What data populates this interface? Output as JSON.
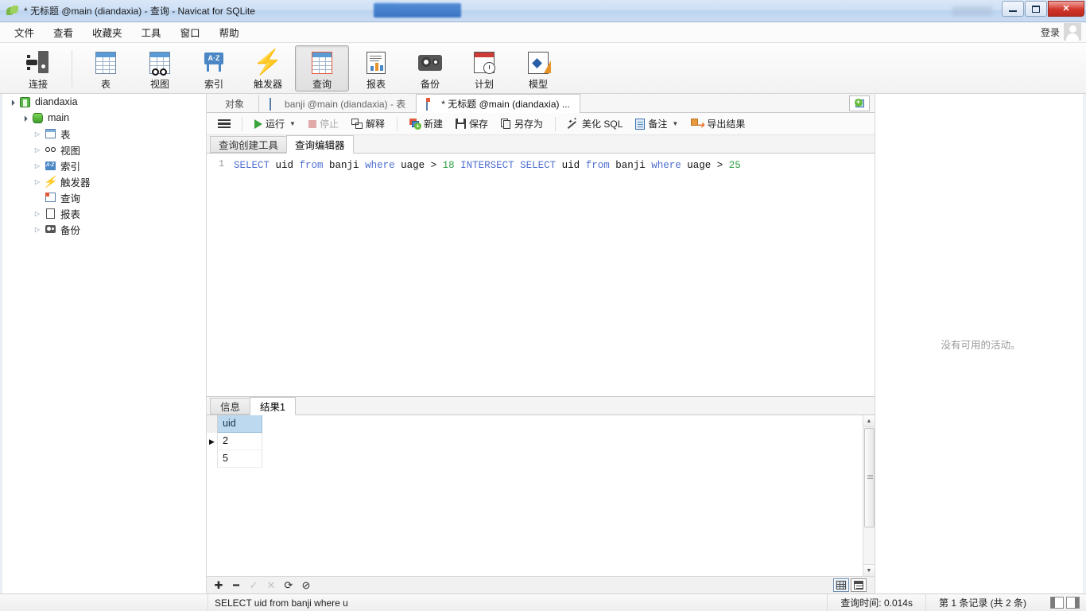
{
  "window": {
    "title": "* 无标题 @main (diandaxia) - 查询 - Navicat for SQLite",
    "app_icon": "navicat-leaf-icon",
    "minimize": "–",
    "maximize": "□",
    "close": "✕"
  },
  "menubar": {
    "items": [
      {
        "label": "文件"
      },
      {
        "label": "查看"
      },
      {
        "label": "收藏夹"
      },
      {
        "label": "工具"
      },
      {
        "label": "窗口"
      },
      {
        "label": "帮助"
      }
    ],
    "login_label": "登录"
  },
  "toolbar": {
    "items": [
      {
        "label": "连接",
        "icon": "connection-icon",
        "active": false
      },
      {
        "label": "表",
        "icon": "table-icon",
        "active": false
      },
      {
        "label": "视图",
        "icon": "view-icon",
        "active": false
      },
      {
        "label": "索引",
        "icon": "index-icon",
        "active": false
      },
      {
        "label": "触发器",
        "icon": "trigger-icon",
        "active": false
      },
      {
        "label": "查询",
        "icon": "query-icon",
        "active": true
      },
      {
        "label": "报表",
        "icon": "report-icon",
        "active": false
      },
      {
        "label": "备份",
        "icon": "backup-icon",
        "active": false
      },
      {
        "label": "计划",
        "icon": "schedule-icon",
        "active": false
      },
      {
        "label": "模型",
        "icon": "model-icon",
        "active": false
      }
    ]
  },
  "sidebar": {
    "items": [
      {
        "label": "diandaxia",
        "icon": "connection-node-icon",
        "depth": 0,
        "twisty": "open"
      },
      {
        "label": "main",
        "icon": "database-icon",
        "depth": 1,
        "twisty": "open"
      },
      {
        "label": "表",
        "icon": "table-folder-icon",
        "depth": 2,
        "twisty": "closed"
      },
      {
        "label": "视图",
        "icon": "view-folder-icon",
        "depth": 2,
        "twisty": "closed"
      },
      {
        "label": "索引",
        "icon": "index-folder-icon",
        "depth": 2,
        "twisty": "closed"
      },
      {
        "label": "触发器",
        "icon": "trigger-folder-icon",
        "depth": 2,
        "twisty": "closed"
      },
      {
        "label": "查询",
        "icon": "query-folder-icon",
        "depth": 2,
        "twisty": "none"
      },
      {
        "label": "报表",
        "icon": "report-folder-icon",
        "depth": 2,
        "twisty": "closed"
      },
      {
        "label": "备份",
        "icon": "backup-folder-icon",
        "depth": 2,
        "twisty": "closed"
      }
    ]
  },
  "tabstrip": {
    "object_tab": "对象",
    "tabs": [
      {
        "label": "banji @main (diandaxia) - 表",
        "icon": "table-tab-icon",
        "active": false
      },
      {
        "label": "* 无标题 @main (diandaxia) ...",
        "icon": "query-tab-icon",
        "active": true
      }
    ],
    "new_tab": "new-tab-button"
  },
  "query_toolbar": {
    "menu": "菜单",
    "run": "运行",
    "stop": "停止",
    "explain": "解释",
    "new": "新建",
    "save": "保存",
    "save_as": "另存为",
    "beautify": "美化 SQL",
    "note": "备注",
    "export": "导出结果"
  },
  "editor_tabs": [
    {
      "label": "查询创建工具",
      "active": false
    },
    {
      "label": "查询编辑器",
      "active": true
    }
  ],
  "editor": {
    "line_number": "1",
    "sql_tokens": [
      {
        "t": "SELECT",
        "c": "kw"
      },
      {
        "t": " uid ",
        "c": "id"
      },
      {
        "t": "from",
        "c": "kw"
      },
      {
        "t": " banji ",
        "c": "id"
      },
      {
        "t": "where",
        "c": "kw"
      },
      {
        "t": " uage > ",
        "c": "id"
      },
      {
        "t": "18",
        "c": "num"
      },
      {
        "t": " ",
        "c": "id"
      },
      {
        "t": "INTERSECT",
        "c": "kw"
      },
      {
        "t": " ",
        "c": "id"
      },
      {
        "t": "SELECT",
        "c": "kw"
      },
      {
        "t": " uid ",
        "c": "id"
      },
      {
        "t": "from",
        "c": "kw"
      },
      {
        "t": " banji ",
        "c": "id"
      },
      {
        "t": "where",
        "c": "kw"
      },
      {
        "t": " uage > ",
        "c": "id"
      },
      {
        "t": "25",
        "c": "num"
      }
    ]
  },
  "results": {
    "tabs": [
      {
        "label": "信息",
        "active": false
      },
      {
        "label": "结果1",
        "active": true
      }
    ],
    "columns": [
      "uid"
    ],
    "rows": [
      {
        "cells": [
          "2"
        ],
        "current": true
      },
      {
        "cells": [
          "5"
        ],
        "current": false
      }
    ],
    "grid_toolbar": [
      {
        "name": "add-record-button",
        "glyph": "✚",
        "disabled": false
      },
      {
        "name": "delete-record-button",
        "glyph": "━",
        "disabled": false
      },
      {
        "name": "apply-changes-button",
        "glyph": "✓",
        "disabled": true
      },
      {
        "name": "cancel-changes-button",
        "glyph": "✕",
        "disabled": true
      },
      {
        "name": "refresh-button",
        "glyph": "⟳",
        "disabled": false
      },
      {
        "name": "stop-button",
        "glyph": "⊘",
        "disabled": false
      }
    ],
    "view_modes": [
      {
        "name": "grid-view-button",
        "selected": true
      },
      {
        "name": "form-view-button",
        "selected": false
      }
    ]
  },
  "right_panel": {
    "empty_text": "没有可用的活动。"
  },
  "statusbar": {
    "sql_preview": "SELECT uid from banji where u",
    "query_time": "查询时间: 0.014s",
    "record_info": "第 1 条记录 (共 2 条)"
  },
  "colors": {
    "accent_blue": "#5b9bd5",
    "header_blue": "#bcd9ef",
    "keyword": "#4f6fd0",
    "number": "#2f9e44",
    "close_red": "#d2352a",
    "green": "#66bb3a",
    "orange": "#e8932a"
  }
}
